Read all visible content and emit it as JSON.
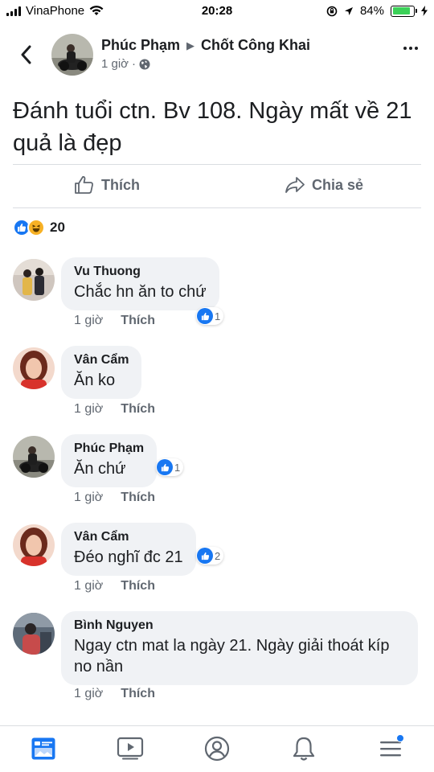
{
  "status_bar": {
    "carrier": "VinaPhone",
    "time": "20:28",
    "battery": "84%",
    "battery_level": 0.84
  },
  "header": {
    "author": "Phúc Phạm",
    "group": "Chốt Công Khai",
    "time": "1 giờ",
    "privacy_icon": "globe-icon"
  },
  "post": {
    "text": "Đánh tuổi ctn. Bv 108. Ngày mất về 21 quả là đẹp"
  },
  "actions": {
    "like_label": "Thích",
    "share_label": "Chia sẻ"
  },
  "reactions": {
    "count": "20",
    "types": [
      "like",
      "haha"
    ]
  },
  "comments": [
    {
      "name": "Vu Thuong",
      "text": "Chắc hn ăn to chứ",
      "time": "1 giờ",
      "like_label": "Thích",
      "reaction_count": "1"
    },
    {
      "name": "Vân Cẩm",
      "text": "Ăn ko",
      "time": "1 giờ",
      "like_label": "Thích",
      "reaction_count": ""
    },
    {
      "name": "Phúc Phạm",
      "text": "Ăn chứ",
      "time": "1 giờ",
      "like_label": "Thích",
      "reaction_count": "1"
    },
    {
      "name": "Vân Cẩm",
      "text": "Đéo nghĩ đc 21",
      "time": "1 giờ",
      "like_label": "Thích",
      "reaction_count": "2"
    },
    {
      "name": "Bình Nguyen",
      "text": "Ngay ctn mat la ngày 21. Ngày giải thoát kíp no nần",
      "time": "1 giờ",
      "like_label": "Thích",
      "reaction_count": ""
    }
  ],
  "bottom_nav": {
    "items": [
      "news-feed-icon",
      "watch-icon",
      "profile-icon",
      "notifications-icon",
      "menu-icon"
    ],
    "accent": "#1877f2"
  }
}
